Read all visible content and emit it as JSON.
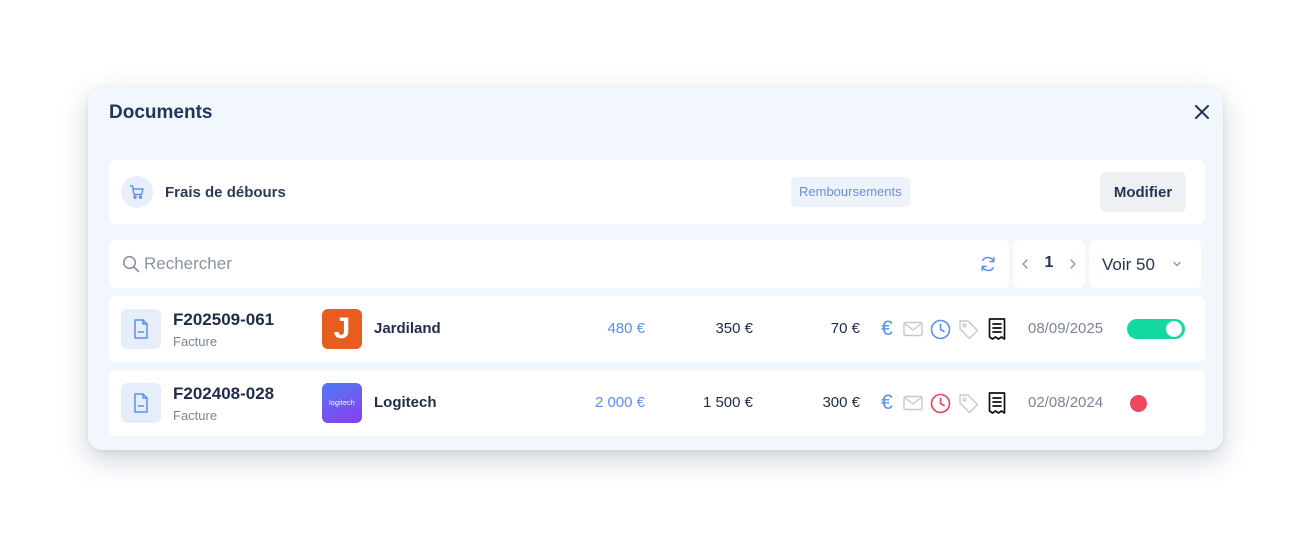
{
  "modal": {
    "title": "Documents"
  },
  "category": {
    "label": "Frais de débours",
    "tag": "Remboursements",
    "edit_label": "Modifier"
  },
  "toolbar": {
    "search_placeholder": "Rechercher",
    "page": "1",
    "per_page": "Voir 50"
  },
  "colors": {
    "accent": "#5b8ff0",
    "title": "#23355a",
    "toggle_on": "#11d9a0",
    "status_red": "#f0475f",
    "clock_red": "#e8415a"
  },
  "rows": [
    {
      "id": "F202509-061",
      "type": "Facture",
      "vendor": "Jardiland",
      "logo_text": "J",
      "total": "480 €",
      "ht": "350 €",
      "tva": "70 €",
      "euro_symbol": "€",
      "clock_status": "blue",
      "date": "08/09/2025",
      "status": "toggle-on"
    },
    {
      "id": "F202408-028",
      "type": "Facture",
      "vendor": "Logitech",
      "logo_text": "logitech",
      "total": "2 000 €",
      "ht": "1 500 €",
      "tva": "300 €",
      "euro_symbol": "€",
      "clock_status": "red",
      "date": "02/08/2024",
      "status": "red-dot"
    }
  ]
}
